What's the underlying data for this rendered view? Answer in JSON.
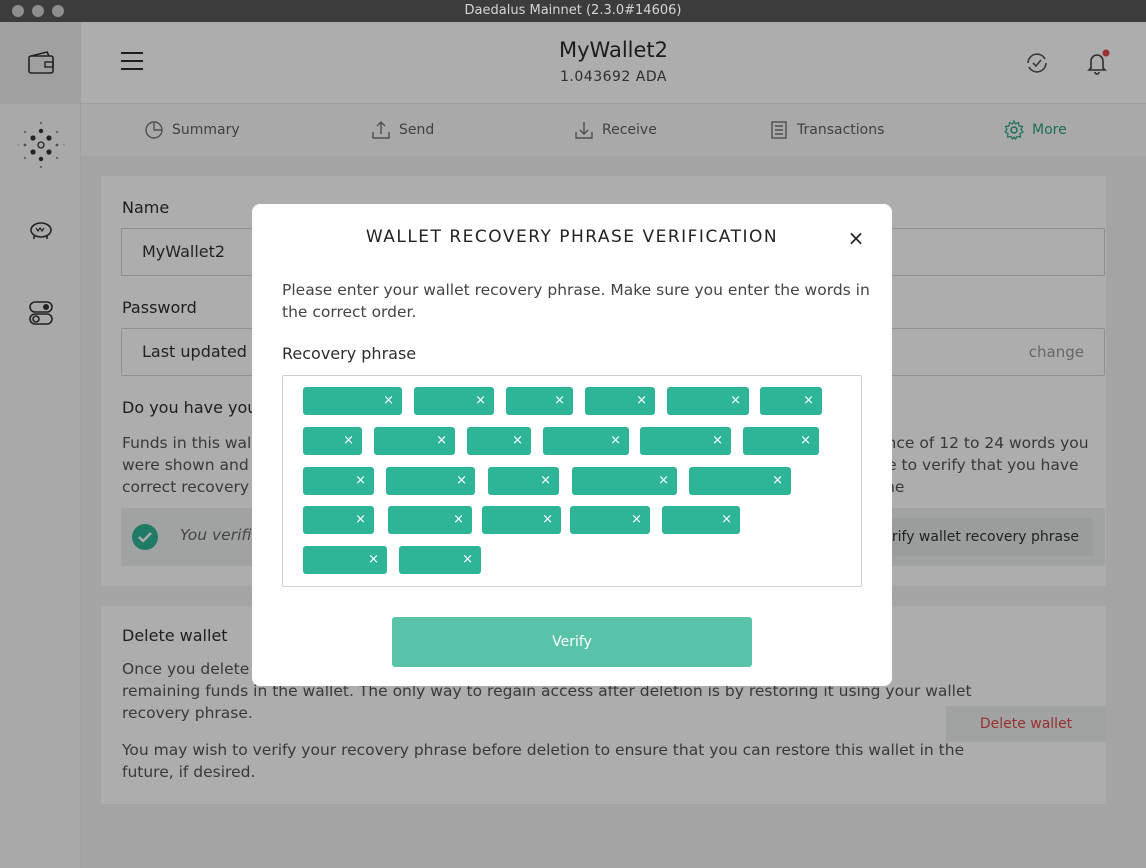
{
  "window": {
    "title": "Daedalus Mainnet (2.3.0#14606)"
  },
  "topbar": {
    "wallet_name": "MyWallet2",
    "balance": "1.043692 ADA"
  },
  "tabs": [
    {
      "label": "Summary",
      "icon": "summary-icon"
    },
    {
      "label": "Send",
      "icon": "send-icon"
    },
    {
      "label": "Receive",
      "icon": "receive-icon"
    },
    {
      "label": "Transactions",
      "icon": "transactions-icon"
    },
    {
      "label": "More",
      "icon": "gear-icon",
      "active": true
    }
  ],
  "settings": {
    "name_label": "Name",
    "name_value": "MyWallet2",
    "password_label": "Password",
    "password_value": "Last updated a",
    "password_action": "change",
    "recovery_heading": "Do you have your",
    "recovery_text_line1": "Funds in this walle",
    "recovery_text_line1_end": "ence of 12 to 24 words you",
    "recovery_text_line2": "were shown and a",
    "recovery_text_line2_end": "se to verify that you have the",
    "recovery_text_line3": "correct recovery p",
    "verified_text": "You verifie",
    "verify_button": "rify wallet recovery phrase"
  },
  "delete_section": {
    "heading": "Delete wallet",
    "line1": "Once you delete t",
    "line2": "remaining funds in the wallet. The only way to regain access after deletion is by restoring it using your wallet",
    "line3": "recovery phrase.",
    "line4": "You may wish to verify your recovery phrase before deletion to ensure that you can restore this wallet in the",
    "line5": "future, if desired.",
    "button": "Delete wallet"
  },
  "modal": {
    "title": "WALLET RECOVERY PHRASE VERIFICATION",
    "close_symbol": "×",
    "description": "Please enter your wallet recovery phrase. Make sure you enter the words in the correct order.",
    "phrase_label": "Recovery phrase",
    "chip_remove_symbol": "×",
    "chip_count": 24,
    "verify_button": "Verify"
  },
  "colors": {
    "accent": "#2eb497",
    "accent_light": "#59c3aa",
    "danger": "#e1474b",
    "notification_dot": "#e1474b"
  }
}
